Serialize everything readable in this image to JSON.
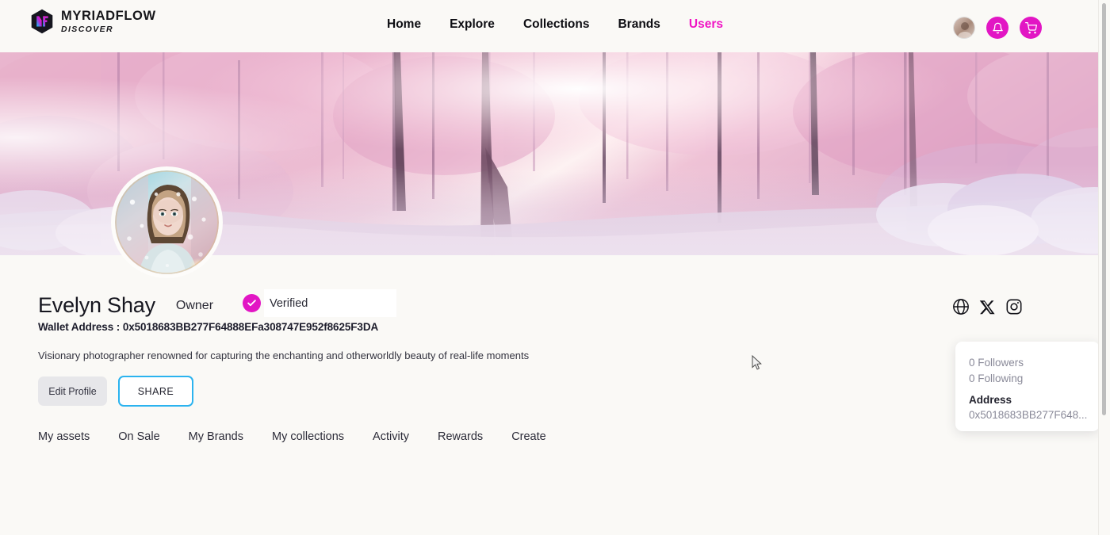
{
  "header": {
    "logo": {
      "mark": "myriadflow-hexagon-logo",
      "title": "MYRIADFLOW",
      "subtitle": "DISCOVER"
    },
    "nav": [
      {
        "label": "Home",
        "active": false
      },
      {
        "label": "Explore",
        "active": false
      },
      {
        "label": "Collections",
        "active": false
      },
      {
        "label": "Brands",
        "active": false
      },
      {
        "label": "Users",
        "active": true
      }
    ],
    "actions": {
      "avatar": "user-avatar",
      "notification_icon": "bell-icon",
      "cart_icon": "cart-icon"
    }
  },
  "banner": {
    "alt": "pink-snowy-forest-banner"
  },
  "profile": {
    "avatar_alt": "evelyn-shay-portrait",
    "display_name": "Evelyn Shay",
    "role": "Owner",
    "verified_label": "Verified",
    "wallet_label": "Wallet Address : 0x5018683BB277F64888EFa308747E952f8625F3DA",
    "bio": "Visionary photographer renowned for capturing the enchanting and otherworldly beauty of real-life moments",
    "edit_button": "Edit Profile",
    "share_button": "SHARE",
    "tabs": [
      {
        "label": "My assets"
      },
      {
        "label": "On Sale"
      },
      {
        "label": "My Brands"
      },
      {
        "label": "My collections"
      },
      {
        "label": "Activity"
      },
      {
        "label": "Rewards"
      },
      {
        "label": "Create"
      }
    ]
  },
  "socials": [
    {
      "name": "website-globe-icon"
    },
    {
      "name": "x-twitter-icon"
    },
    {
      "name": "instagram-icon"
    }
  ],
  "info_card": {
    "followers": "0 Followers",
    "following": "0 Following",
    "address_title": "Address",
    "address_value": "0x5018683BB277F648..."
  },
  "colors": {
    "brand_magenta": "#e216c4",
    "nav_active": "#f013c4",
    "share_border": "#2bb3ef",
    "page_background": "#faf9f6",
    "edit_button_bg": "#e7e7ea"
  }
}
